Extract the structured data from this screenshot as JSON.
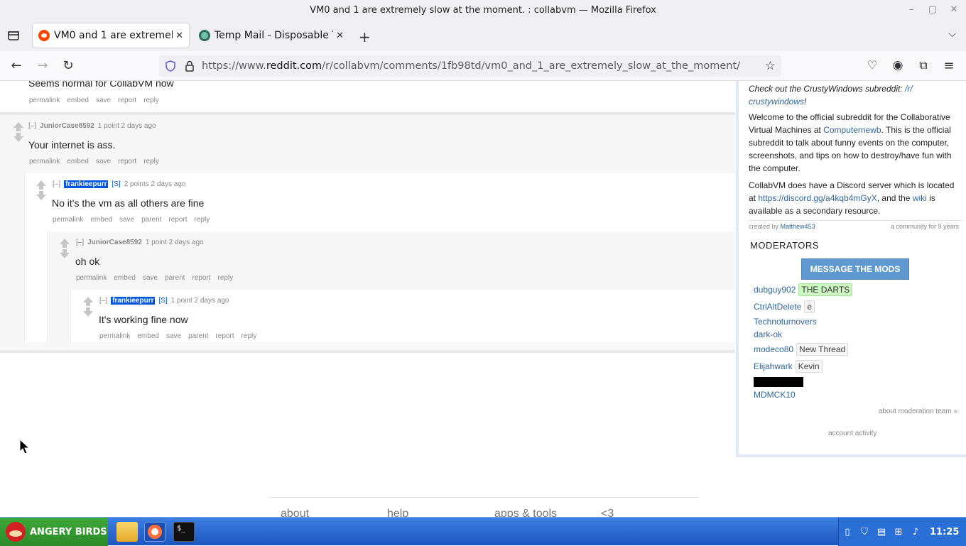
{
  "window": {
    "title": "VM0 and 1 are extremely slow at the moment. : collabvm — Mozilla Firefox"
  },
  "tabs": [
    {
      "label": "VM0 and 1 are extremely slow at the moment. : collabvm",
      "active": true
    },
    {
      "label": "Temp Mail - Disposable Temporary Email",
      "active": false
    }
  ],
  "urlbar": {
    "prefix": "https://www.",
    "domain": "reddit.com",
    "path": "/r/collabvm/comments/1fb98td/vm0_and_1_are_extremely_slow_at_the_moment/"
  },
  "comments": [
    {
      "text": "Seems normal for CollabVM now",
      "actions": [
        "permalink",
        "embed",
        "save",
        "report",
        "reply"
      ]
    },
    {
      "collapse": "[–]",
      "author": "JuniorCase8592",
      "submitter": "",
      "meta": "1 point 2 days ago",
      "text": "Your internet is ass.",
      "actions": [
        "permalink",
        "embed",
        "save",
        "report",
        "reply"
      ]
    },
    {
      "collapse": "[–]",
      "author": "frankieepurr",
      "submitter": "[S]",
      "meta": "2 points 2 days ago",
      "text": "No it's the vm as all others are fine",
      "actions": [
        "permalink",
        "embed",
        "save",
        "parent",
        "report",
        "reply"
      ]
    },
    {
      "collapse": "[–]",
      "author": "JuniorCase8592",
      "submitter": "",
      "meta": "1 point 2 days ago",
      "text": "oh ok",
      "actions": [
        "permalink",
        "embed",
        "save",
        "parent",
        "report",
        "reply"
      ]
    },
    {
      "collapse": "[–]",
      "author": "frankieepurr",
      "submitter": "[S]",
      "meta": "1 point 2 days ago",
      "text": "It's working fine now",
      "actions": [
        "permalink",
        "embed",
        "save",
        "parent",
        "report",
        "reply"
      ]
    }
  ],
  "sidebar": {
    "crusty_prefix": "Check out the CrustyWindows subreddit: ",
    "crusty_link_1": "/r/",
    "crusty_link_2": "crustywindows",
    "crusty_suffix": "!",
    "welcome_1": "Welcome to the official subreddit for the Collaborative Virtual Machines at ",
    "welcome_link": "Computernewb",
    "welcome_2": ". This is the official subreddit to talk about funny events on the computer, screenshots, and tips on how to destroy/have fun with the computer.",
    "discord_1": "CollabVM does have a Discord server which is located at ",
    "discord_link": "https://discord.gg/a4kqb4mGyX",
    "discord_2": ", and the ",
    "wiki_link": "wiki",
    "discord_3": " is available as a secondary resource.",
    "created_by_label": "created by",
    "created_by_user": "Matthew453",
    "community_age": "a community for 9 years",
    "moderators_title": "MODERATORS",
    "message_mods": "MESSAGE THE MODS",
    "moderators": [
      {
        "name": "dubguy902",
        "flair": "THE DARTS",
        "flair_style": "green"
      },
      {
        "name": "CtrlAltDelete",
        "flair": "e",
        "flair_style": "grey"
      },
      {
        "name": "Technoturnovers",
        "flair": "",
        "flair_style": ""
      },
      {
        "name": "dark-ok",
        "flair": "",
        "flair_style": ""
      },
      {
        "name": "modeco80",
        "flair": "New Thread",
        "flair_style": "grey"
      },
      {
        "name": "Elijahwark",
        "flair": "Kevin",
        "flair_style": "grey"
      },
      {
        "name": "MDMCK10",
        "flair": "",
        "flair_style": ""
      }
    ],
    "about_mod_team": "about moderation team »",
    "account_activity": "account activity"
  },
  "footer": [
    "about",
    "help",
    "apps & tools",
    "<3"
  ],
  "taskbar": {
    "start_label": "ANGERY BIRDS",
    "clock": "11:25"
  },
  "colors": {
    "op_highlight": "#0055df",
    "link": "#336699",
    "message_button": "#5f99cf",
    "taskbar": "#1d55c0",
    "start_button": "#2b8a2a"
  }
}
